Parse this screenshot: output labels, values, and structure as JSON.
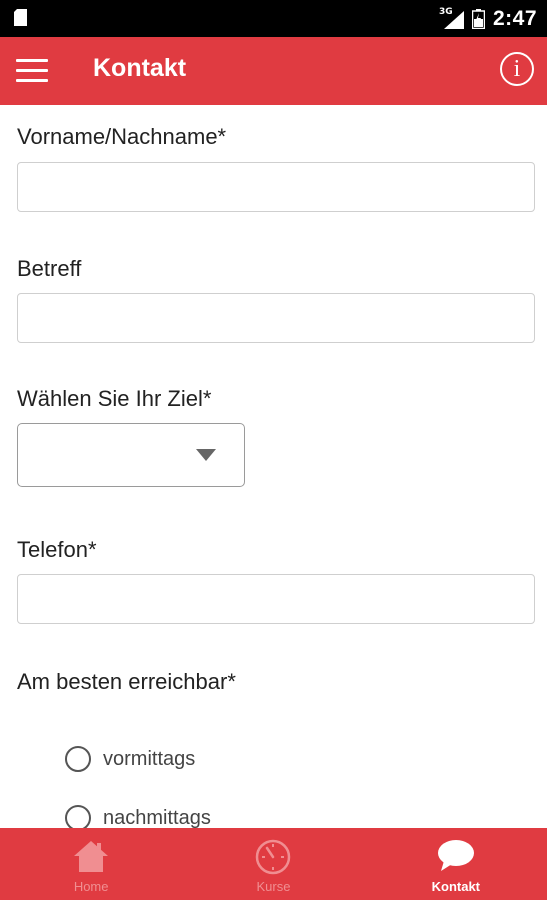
{
  "status_bar": {
    "network": "3G",
    "time": "2:47",
    "icons": [
      "sd-card-icon",
      "signal-icon",
      "battery-icon"
    ]
  },
  "app_bar": {
    "title": "Kontakt",
    "menu_icon": "hamburger-menu-icon",
    "info_icon": "info-icon",
    "info_glyph": "i",
    "background_color": "#e03b41"
  },
  "form": {
    "name_label": "Vorname/Nachname*",
    "name_value": "",
    "subject_label": "Betreff",
    "subject_value": "",
    "goal_label": "Wählen Sie Ihr Ziel*",
    "goal_selected": "",
    "phone_label": "Telefon*",
    "phone_value": "",
    "reachable_label": "Am besten erreichbar*",
    "reachable_options": [
      {
        "label": "vormittags",
        "checked": false
      },
      {
        "label": "nachmittags",
        "checked": false
      }
    ]
  },
  "bottom_nav": {
    "items": [
      {
        "label": "Home",
        "icon": "home-icon",
        "active": false
      },
      {
        "label": "Kurse",
        "icon": "stopwatch-icon",
        "active": false
      },
      {
        "label": "Kontakt",
        "icon": "chat-bubble-icon",
        "active": true
      }
    ],
    "background_color": "#e03b41"
  }
}
